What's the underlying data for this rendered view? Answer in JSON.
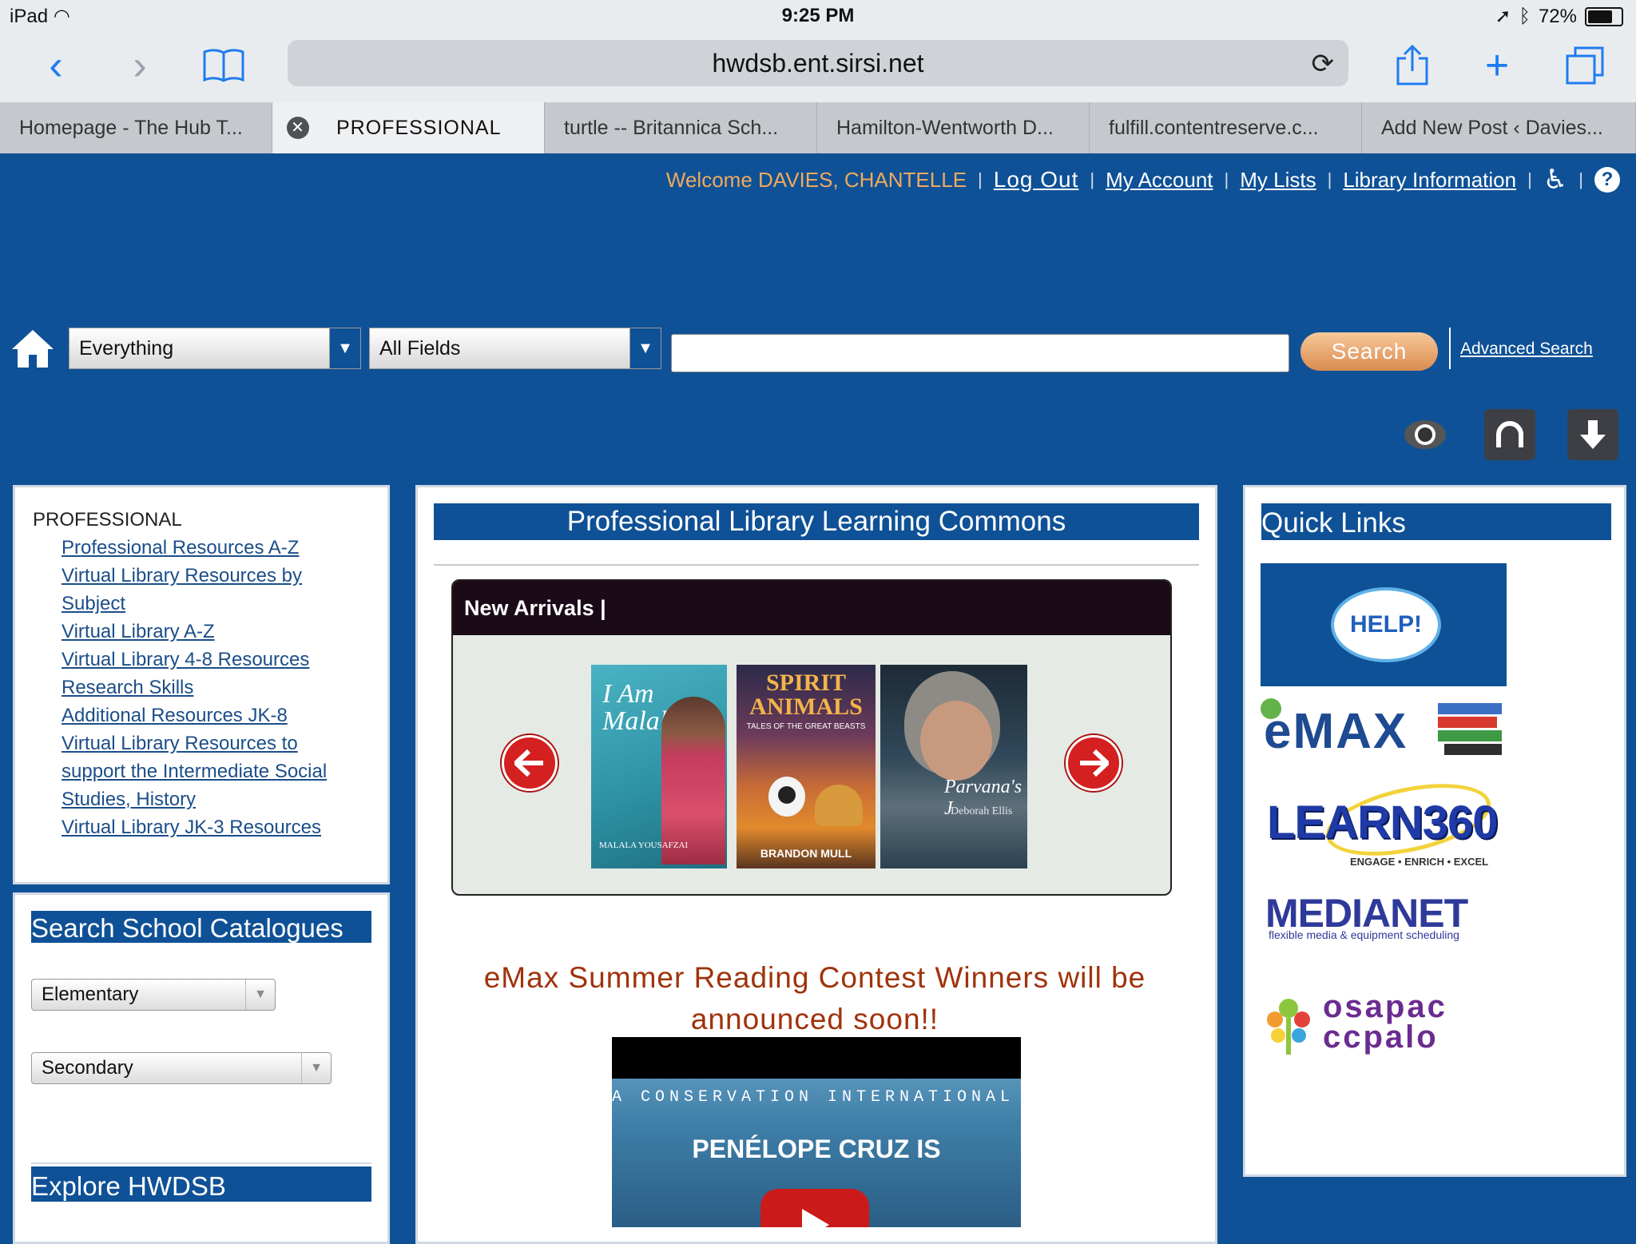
{
  "status_bar": {
    "device": "iPad",
    "time": "9:25 PM",
    "battery": "72%"
  },
  "browser": {
    "url": "hwdsb.ent.sirsi.net",
    "tabs": [
      {
        "label": "Homepage - The Hub T..."
      },
      {
        "label": "PROFESSIONAL"
      },
      {
        "label": "turtle -- Britannica Sch..."
      },
      {
        "label": "Hamilton-Wentworth D..."
      },
      {
        "label": "fulfill.contentreserve.c..."
      },
      {
        "label": "Add New Post ‹ Davies..."
      }
    ]
  },
  "header": {
    "welcome": "Welcome DAVIES, CHANTELLE",
    "links": {
      "logout": "Log Out",
      "account": "My Account",
      "lists": "My Lists",
      "info": "Library Information"
    }
  },
  "search": {
    "scope": "Everything",
    "field": "All Fields",
    "query": "",
    "button": "Search",
    "advanced": "Advanced Search"
  },
  "left_panel": {
    "heading": "PROFESSIONAL",
    "links": [
      "Professional Resources A-Z",
      "Virtual Library Resources by Subject",
      "Virtual Library A-Z",
      "Virtual Library 4-8 Resources",
      "Research Skills",
      "Additional Resources JK-8",
      "Virtual Library Resources to support the Intermediate Social Studies, History",
      "Virtual Library JK-3 Resources"
    ]
  },
  "catalogues": {
    "title": "Search School Catalogues",
    "elementary": "Elementary",
    "secondary": "Secondary"
  },
  "explore": {
    "title": "Explore HWDSB"
  },
  "main": {
    "title": "Professional Library Learning Commons",
    "carousel_title": "New Arrivals |",
    "books": [
      {
        "title": "I Am Malala",
        "author": "MALALA YOUSAFZAI",
        "colors": [
          "#3aa4b5",
          "#d94f6b"
        ]
      },
      {
        "title": "SPIRIT ANIMALS",
        "subtitle": "TALES OF THE GREAT BEASTS",
        "author": "BRANDON MULL",
        "colors": [
          "#2c2a4a",
          "#e08a2c"
        ]
      },
      {
        "title": "Parvana's J",
        "author": "Deborah Ellis",
        "colors": [
          "#2b4150",
          "#6b7d86"
        ]
      }
    ],
    "announcement": "eMax Summer Reading Contest Winners will be announced soon!!",
    "video": {
      "top_text": "A CONSERVATION INTERNATIONAL FILM",
      "mid_text": "PENÉLOPE CRUZ IS"
    }
  },
  "quick_links": {
    "title": "Quick Links",
    "help": "HELP!",
    "emax": "eMAX",
    "learn360": "LEARN360",
    "learn360_tag": "ENGAGE • ENRICH • EXCEL",
    "medianet": "MEDIANET",
    "medianet_tag": "flexible media & equipment scheduling",
    "osapac_1": "osapac",
    "osapac_2": "ccpalo"
  }
}
